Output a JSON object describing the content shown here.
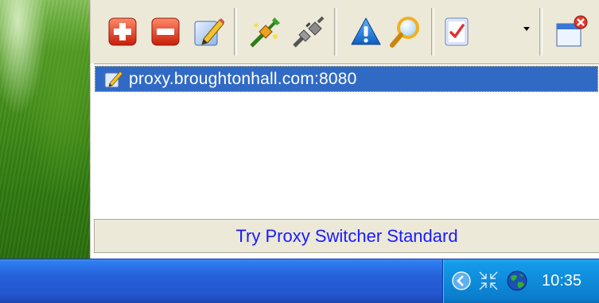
{
  "toolbar": {
    "buttons": [
      {
        "name": "add-proxy",
        "icon": "plus-icon"
      },
      {
        "name": "delete-proxy",
        "icon": "minus-icon"
      },
      {
        "name": "edit-proxy",
        "icon": "edit-pencil-icon"
      },
      {
        "name": "connect",
        "icon": "plug-connected-icon"
      },
      {
        "name": "disconnect",
        "icon": "plug-disconnected-icon"
      },
      {
        "name": "warning",
        "icon": "warning-triangle-icon"
      },
      {
        "name": "search",
        "icon": "magnifier-icon"
      },
      {
        "name": "check-dropdown",
        "icon": "document-check-icon"
      },
      {
        "name": "close",
        "icon": "window-close-icon"
      }
    ]
  },
  "proxy_list": {
    "items": [
      {
        "label": "proxy.broughtonhall.com:8080",
        "selected": true
      }
    ]
  },
  "promo": {
    "link_text": "Try Proxy Switcher Standard"
  },
  "taskbar": {
    "clock": "10:35",
    "tray_icons": [
      "expand-tray-icon",
      "network-grid-icon",
      "globe-icon"
    ]
  },
  "colors": {
    "selection": "#316ac5",
    "link": "#1a1aff",
    "taskbar": "#2560d8",
    "tray": "#0e8bd9"
  }
}
